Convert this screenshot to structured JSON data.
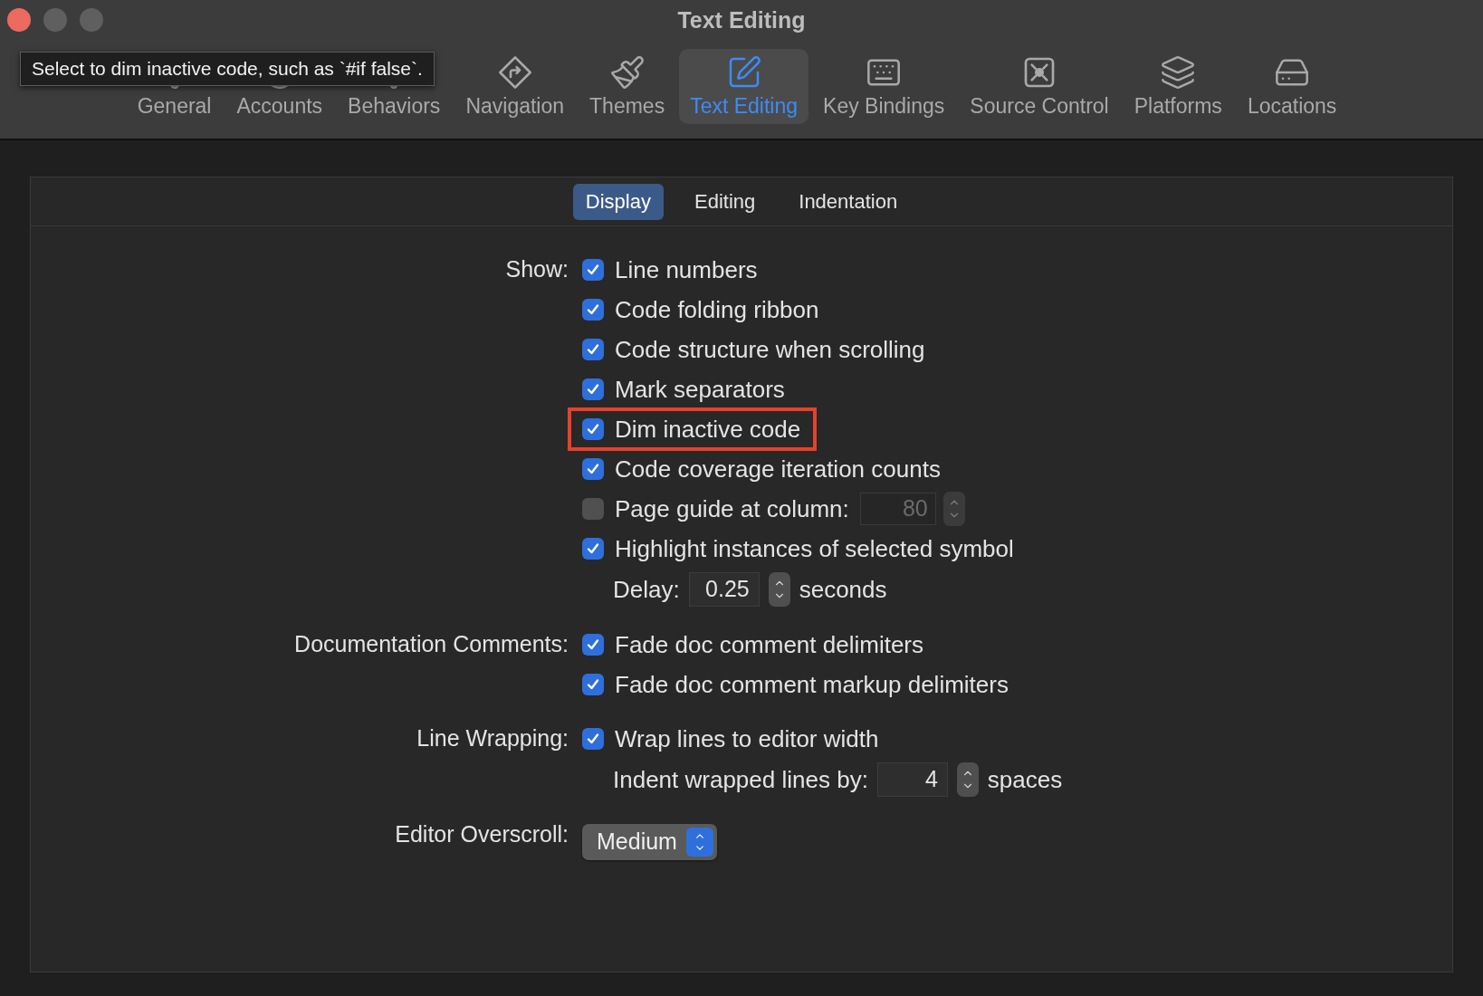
{
  "window": {
    "title": "Text Editing"
  },
  "tooltip": {
    "text": "Select to dim inactive code, such as `#if false`."
  },
  "toolbar": [
    {
      "kind": "general",
      "label": "General",
      "selected": false
    },
    {
      "kind": "accounts",
      "label": "Accounts",
      "selected": false
    },
    {
      "kind": "behaviors",
      "label": "Behaviors",
      "selected": false
    },
    {
      "kind": "navigation",
      "label": "Navigation",
      "selected": false
    },
    {
      "kind": "themes",
      "label": "Themes",
      "selected": false
    },
    {
      "kind": "text",
      "label": "Text Editing",
      "selected": true
    },
    {
      "kind": "keys",
      "label": "Key Bindings",
      "selected": false
    },
    {
      "kind": "source",
      "label": "Source Control",
      "selected": false
    },
    {
      "kind": "platforms",
      "label": "Platforms",
      "selected": false
    },
    {
      "kind": "locations",
      "label": "Locations",
      "selected": false
    }
  ],
  "subtabs": [
    {
      "label": "Display",
      "selected": true
    },
    {
      "label": "Editing",
      "selected": false
    },
    {
      "label": "Indentation",
      "selected": false
    }
  ],
  "sections": [
    {
      "label": "Show:",
      "rows": [
        {
          "kind": "checkbox",
          "label": "Line numbers",
          "checked": true,
          "highlighted": false
        },
        {
          "kind": "checkbox",
          "label": "Code folding ribbon",
          "checked": true,
          "highlighted": false
        },
        {
          "kind": "checkbox",
          "label": "Code structure when scrolling",
          "checked": true,
          "highlighted": false
        },
        {
          "kind": "checkbox",
          "label": "Mark separators",
          "checked": true,
          "highlighted": false
        },
        {
          "kind": "checkbox",
          "label": "Dim inactive code",
          "checked": true,
          "highlighted": true
        },
        {
          "kind": "checkbox",
          "label": "Code coverage iteration counts",
          "checked": true,
          "highlighted": false
        },
        {
          "kind": "checkfield",
          "label": "Page guide at column:",
          "checked": false,
          "value": "80",
          "disabled": true
        },
        {
          "kind": "checkbox",
          "label": "Highlight instances of selected symbol",
          "checked": true,
          "highlighted": false
        },
        {
          "kind": "stepper",
          "label": "Delay:",
          "value": "0.25",
          "unit": "seconds"
        }
      ]
    },
    {
      "label": "Documentation Comments:",
      "rows": [
        {
          "kind": "checkbox",
          "label": "Fade doc comment delimiters",
          "checked": true,
          "highlighted": false
        },
        {
          "kind": "checkbox",
          "label": "Fade doc comment markup delimiters",
          "checked": true,
          "highlighted": false
        }
      ]
    },
    {
      "label": "Line Wrapping:",
      "rows": [
        {
          "kind": "checkbox",
          "label": "Wrap lines to editor width",
          "checked": true,
          "highlighted": false
        },
        {
          "kind": "stepper",
          "label": "Indent wrapped lines by:",
          "value": "4",
          "unit": "spaces"
        }
      ]
    },
    {
      "label": "Editor Overscroll:",
      "rows": [
        {
          "kind": "popup",
          "value": "Medium"
        }
      ]
    }
  ]
}
